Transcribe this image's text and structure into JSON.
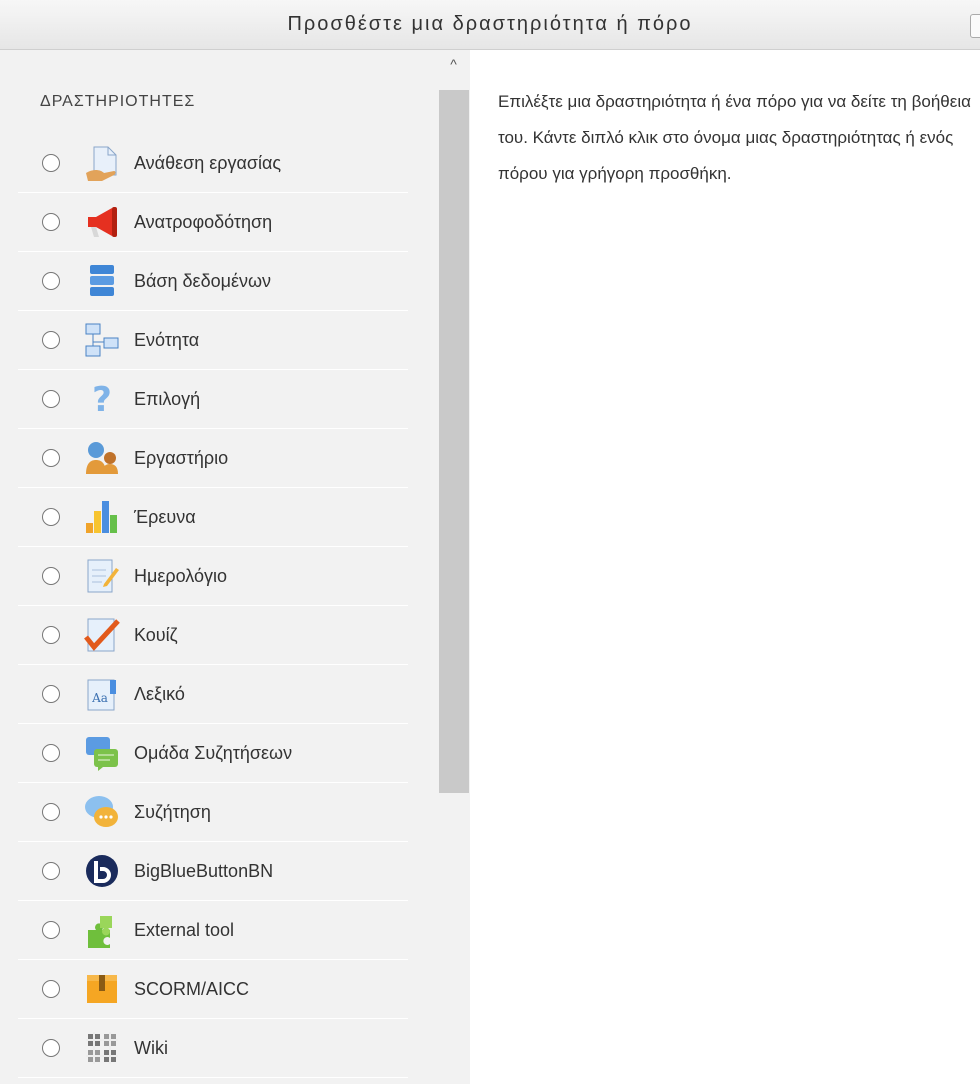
{
  "dialog": {
    "title": "Προσθέστε μια δραστηριότητα ή πόρο"
  },
  "activities": {
    "heading": "ΔΡΑΣΤΗΡΙΟΤΗΤΕΣ",
    "items": [
      {
        "label": "Ανάθεση εργασίας",
        "icon": "assignment-icon"
      },
      {
        "label": "Ανατροφοδότηση",
        "icon": "feedback-megaphone-icon"
      },
      {
        "label": "Βάση δεδομένων",
        "icon": "database-icon"
      },
      {
        "label": "Ενότητα",
        "icon": "lesson-icon"
      },
      {
        "label": "Επιλογή",
        "icon": "choice-question-icon"
      },
      {
        "label": "Εργαστήριο",
        "icon": "workshop-icon"
      },
      {
        "label": "Έρευνα",
        "icon": "survey-chart-icon"
      },
      {
        "label": "Ημερολόγιο",
        "icon": "journal-icon"
      },
      {
        "label": "Κουίζ",
        "icon": "quiz-check-icon"
      },
      {
        "label": "Λεξικό",
        "icon": "glossary-icon"
      },
      {
        "label": "Ομάδα Συζητήσεων",
        "icon": "forum-icon"
      },
      {
        "label": "Συζήτηση",
        "icon": "chat-icon"
      },
      {
        "label": "BigBlueButtonBN",
        "icon": "bigbluebutton-icon"
      },
      {
        "label": "External tool",
        "icon": "external-tool-puzzle-icon"
      },
      {
        "label": "SCORM/AICC",
        "icon": "scorm-package-icon"
      },
      {
        "label": "Wiki",
        "icon": "wiki-icon"
      }
    ]
  },
  "help": {
    "text": "Επιλέξτε μια δραστηριότητα ή ένα πόρο για να δείτε τη βοήθεια του. Κάντε διπλό κλικ στο όνομα μιας δραστηριότητας ή ενός πόρου για γρήγορη προσθήκη."
  },
  "scrollbar": {
    "up_arrow": "^"
  },
  "colors": {
    "panel_bg": "#f2f2f2",
    "header_bg": "#ececec",
    "scroll_thumb": "#c9c9c9"
  }
}
